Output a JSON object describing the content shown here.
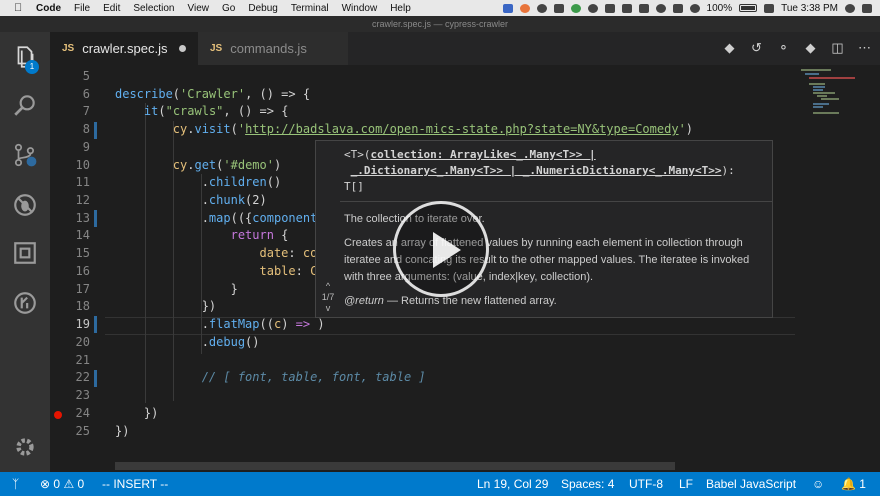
{
  "menubar": {
    "app": "Code",
    "items": [
      "File",
      "Edit",
      "Selection",
      "View",
      "Go",
      "Debug",
      "Terminal",
      "Window",
      "Help"
    ],
    "battery": "100%",
    "clock": "Tue 3:38 PM"
  },
  "window": {
    "title": "crawler.spec.js — cypress-crawler"
  },
  "activity": {
    "badge": "1"
  },
  "tabs": [
    {
      "icon": "JS",
      "label": "crawler.spec.js",
      "modified": true
    },
    {
      "icon": "JS",
      "label": "commands.js"
    }
  ],
  "editor": {
    "line_numbers": [
      "5",
      "6",
      "7",
      "8",
      "9",
      "10",
      "11",
      "12",
      "13",
      "14",
      "15",
      "16",
      "17",
      "18",
      "19",
      "20",
      "21",
      "22",
      "23",
      "24",
      "25"
    ],
    "lines": [
      "",
      "describe('Crawler', () => {",
      "    it(\"crawls\", () => {",
      "        cy.visit('http://badslava.com/open-mics-state.php?state=NY&type=Comedy')",
      "",
      "        cy.get('#demo')",
      "            .children()",
      "            .chunk(2)",
      "            .map(({components",
      "                return {",
      "                    date: co",
      "                    table: C",
      "                }",
      "            })",
      "            .flatMap((c) => )",
      "            .debug()",
      "",
      "            // [ font, table, font, table ]",
      "",
      "    })",
      "})"
    ]
  },
  "hover": {
    "sig_line1_pre": "<T>(",
    "sig_line1_param": "collection: ArrayLike<_.Many<T>> |",
    "sig_line2": "_.Dictionary<_.Many<T>> | _.NumericDictionary<_.Many<T>>",
    "sig_line2_post": "):",
    "sig_line3": "T[]",
    "param_doc": "The collection to iterate over.",
    "description": "Creates an array of flattened values by running each element in collection through iteratee and concating its result to the other mapped values. The iteratee is invoked with three arguments: (value, index|key, collection).",
    "return_tag": "@return",
    "return_doc": " — Returns the new flattened array.",
    "nav_up": "^",
    "nav_count": "1/7",
    "nav_down": "v"
  },
  "statusbar": {
    "errors": "0",
    "warnings": "0",
    "mode": "-- INSERT --",
    "position": "Ln 19, Col 29",
    "spaces": "Spaces: 4",
    "encoding": "UTF-8",
    "eol": "LF",
    "language": "Babel JavaScript",
    "notifications": "1"
  }
}
